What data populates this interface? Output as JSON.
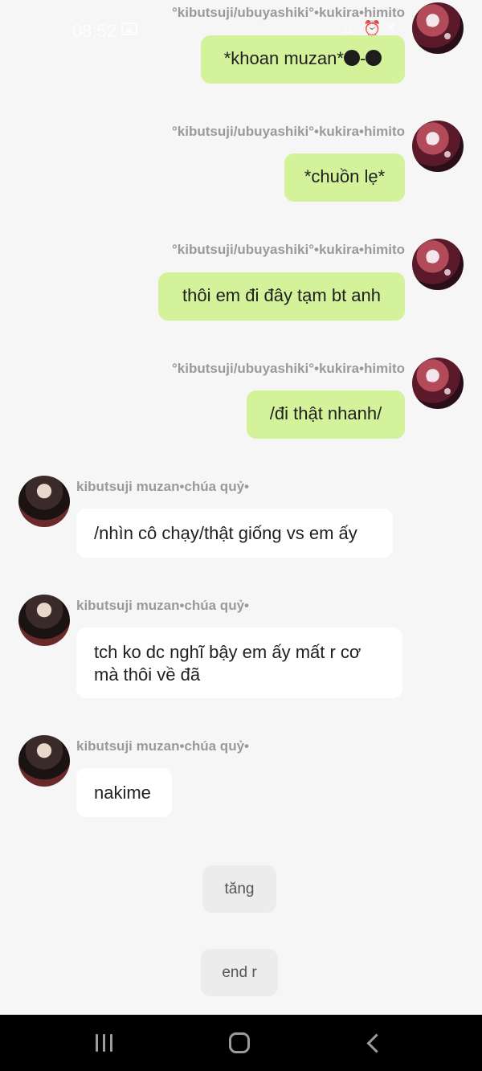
{
  "status_bar": {
    "time": "08:52"
  },
  "messages": [
    {
      "side": "out",
      "sender": "°kibutsuji/ubuyashiki°•kukira•himito",
      "text": "*khoan muzan*",
      "suffix": "-"
    },
    {
      "side": "out",
      "sender": "°kibutsuji/ubuyashiki°•kukira•himito",
      "text": "*chuồn lẹ*"
    },
    {
      "side": "out",
      "sender": "°kibutsuji/ubuyashiki°•kukira•himito",
      "text": "thôi em đi đây tạm bt anh"
    },
    {
      "side": "out",
      "sender": "°kibutsuji/ubuyashiki°•kukira•himito",
      "text": "/đi thật nhanh/"
    },
    {
      "side": "in",
      "sender": "kibutsuji muzan•chúa quỷ•",
      "text": "/nhìn cô chạy/thật giống vs em ấy"
    },
    {
      "side": "in",
      "sender": "kibutsuji muzan•chúa quỷ•",
      "text": "tch ko dc nghĩ bậy em ấy mất r cơ mà thôi về đã"
    },
    {
      "side": "in",
      "sender": "kibutsuji muzan•chúa quỷ•",
      "text": "nakime"
    }
  ],
  "actions": [
    {
      "label": "tăng"
    },
    {
      "label": "end r"
    }
  ],
  "colors": {
    "outgoing_bubble": "#d3f29a",
    "incoming_bubble": "#ffffff",
    "background": "#f6f6f6",
    "name_text": "#9a9a9a"
  },
  "nav_icons": [
    "recents-icon",
    "home-icon",
    "back-icon"
  ]
}
